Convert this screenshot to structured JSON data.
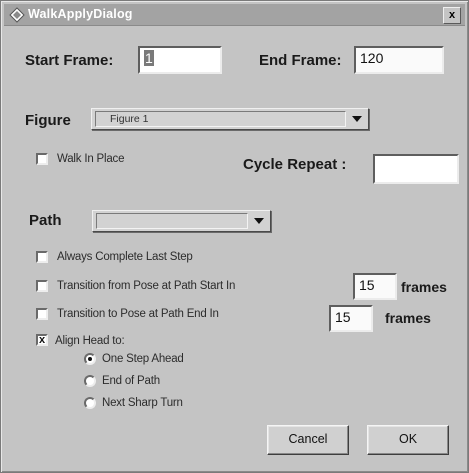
{
  "window": {
    "title": "WalkApplyDialog",
    "close_label": "x"
  },
  "start_frame": {
    "label": "Start Frame:",
    "value": "1"
  },
  "end_frame": {
    "label": "End Frame:",
    "value": "120"
  },
  "figure": {
    "label": "Figure",
    "selected": "Figure 1"
  },
  "walk_in_place": {
    "label": "Walk In Place",
    "checked": false
  },
  "cycle_repeat": {
    "label": "Cycle Repeat :",
    "value": ""
  },
  "path": {
    "label": "Path",
    "selected": ""
  },
  "options": {
    "always_complete": {
      "label": "Always Complete Last Step",
      "checked": false
    },
    "transition_from": {
      "label": "Transition from Pose at Path Start In",
      "checked": false,
      "value": "15",
      "unit": "frames"
    },
    "transition_to": {
      "label": "Transition to Pose at Path End In",
      "checked": false,
      "value": "15",
      "unit": "frames"
    },
    "align_head": {
      "label": "Align Head to:",
      "checked": true,
      "check_glyph": "x"
    }
  },
  "align_choices": [
    {
      "label": "One Step Ahead",
      "selected": true
    },
    {
      "label": "End of Path",
      "selected": false
    },
    {
      "label": "Next Sharp Turn",
      "selected": false
    }
  ],
  "buttons": {
    "cancel": "Cancel",
    "ok": "OK"
  },
  "icons": {
    "title": "app-diamond-icon",
    "dropdown": "chevron-down-icon"
  }
}
